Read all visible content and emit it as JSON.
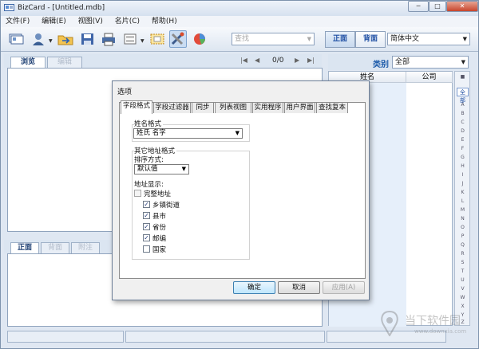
{
  "window": {
    "title": "BizCard - [Untitled.mdb]"
  },
  "menu": [
    {
      "label": "文件(F)"
    },
    {
      "label": "编辑(E)"
    },
    {
      "label": "视图(V)"
    },
    {
      "label": "名片(C)"
    },
    {
      "label": "帮助(H)"
    }
  ],
  "toolbar": {
    "search_placeholder": "查找",
    "front_label": "正面",
    "back_label": "背面",
    "language_value": "简体中文"
  },
  "left_panel": {
    "tabs": [
      {
        "label": "浏览"
      },
      {
        "label": "编辑"
      }
    ],
    "page_counter": "0/0",
    "bottom_tabs": [
      {
        "label": "正面"
      },
      {
        "label": "背面"
      },
      {
        "label": "附注"
      }
    ]
  },
  "right_panel": {
    "category_label": "类别",
    "category_value": "全部",
    "columns": [
      {
        "label": "姓名"
      },
      {
        "label": "公司"
      }
    ],
    "alphabet": [
      "全部",
      "A",
      "B",
      "C",
      "D",
      "E",
      "F",
      "G",
      "H",
      "I",
      "J",
      "K",
      "L",
      "M",
      "N",
      "O",
      "P",
      "Q",
      "R",
      "S",
      "T",
      "U",
      "V",
      "W",
      "X",
      "Y",
      "Z"
    ]
  },
  "dialog": {
    "title": "选项",
    "tabs": [
      {
        "label": "字段格式"
      },
      {
        "label": "字段过滤器"
      },
      {
        "label": "同步"
      },
      {
        "label": "列表视图"
      },
      {
        "label": "实用程序"
      },
      {
        "label": "用户界面"
      },
      {
        "label": "查找复本"
      }
    ],
    "name_format_label": "姓名格式",
    "name_format_value": "姓氏 名字",
    "other_address_label": "其它地址格式",
    "sort_label": "排序方式:",
    "sort_value": "默认值",
    "address_display_label": "地址显示:",
    "full_address": {
      "label": "完整地址",
      "checked": false
    },
    "address_options": [
      {
        "label": "乡镇街道",
        "checked": true
      },
      {
        "label": "县市",
        "checked": true
      },
      {
        "label": "省份",
        "checked": true
      },
      {
        "label": "邮编",
        "checked": true
      },
      {
        "label": "国家",
        "checked": false
      }
    ],
    "ok_label": "确定",
    "cancel_label": "取消",
    "apply_label": "应用(A)"
  },
  "watermark_text": "当下软件园",
  "watermark_url": "www.downxia.com"
}
